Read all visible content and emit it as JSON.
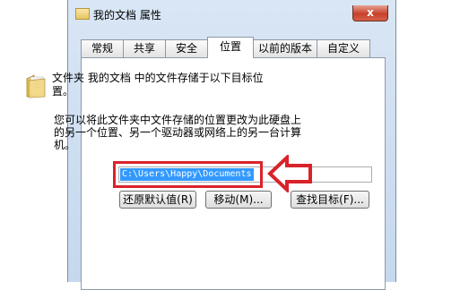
{
  "window": {
    "title": "我的文档 属性",
    "close_label": "x"
  },
  "tabs": [
    {
      "label": "常规"
    },
    {
      "label": "共享"
    },
    {
      "label": "安全"
    },
    {
      "label": "位置",
      "active": true
    },
    {
      "label": "以前的版本"
    },
    {
      "label": "自定义"
    }
  ],
  "content": {
    "description_line1": "文件夹 我的文档 中的文件存储于以下目标位",
    "description_line2": "置。",
    "info_line1": "您可以将此文件夹中文件存储的位置更改为此硬盘上",
    "info_line2": "的另一个位置、另一个驱动器或网络上的另一台计算",
    "info_line3": "机。",
    "path_value": "C:\\Users\\Happy\\Documents"
  },
  "buttons": {
    "restore_default": "还原默认值(R)",
    "move": "移动(M)...",
    "find_target": "查找目标(F)..."
  },
  "annotation": {
    "highlight_color": "#d9232a"
  },
  "icons": {
    "folder": "folder-icon",
    "close": "close-icon",
    "arrow": "left-arrow-icon"
  }
}
